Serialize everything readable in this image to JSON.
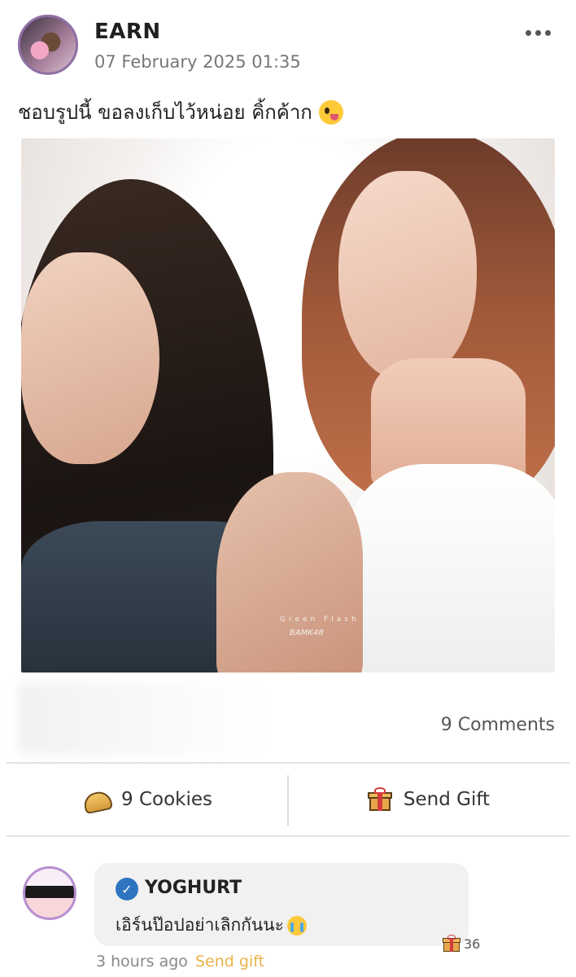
{
  "post": {
    "author": "EARN",
    "timestamp": "07 February 2025 01:35",
    "caption": "ชอบรูปนี้ ขอลงเก็บไว้หน่อย คิ้กค้าก",
    "caption_emoji": "zany-face-emoji",
    "photo": {
      "watermark_line1": "Green Flash",
      "watermark_line2": "BAMK48"
    }
  },
  "stats": {
    "comments": "9 Comments"
  },
  "actions": {
    "cookies_label": "9 Cookies",
    "send_gift_label": "Send Gift",
    "cookie_icon": "fortune-cookie-icon",
    "gift_icon": "gift-icon"
  },
  "comment": {
    "name": "YOGHURT",
    "verified_icon": "verified-badge-icon",
    "text": "เอิร์นป๊อปอย่าเลิกกันนะ",
    "text_emoji": "crying-cat-emoji",
    "gift_count": "36",
    "time": "3 hours ago",
    "send_gift_label": "Send gift"
  },
  "colors": {
    "accent_gift_link": "#e9b24a",
    "avatar_border": "#8e6fa6",
    "verified_blue": "#2f74c0"
  }
}
